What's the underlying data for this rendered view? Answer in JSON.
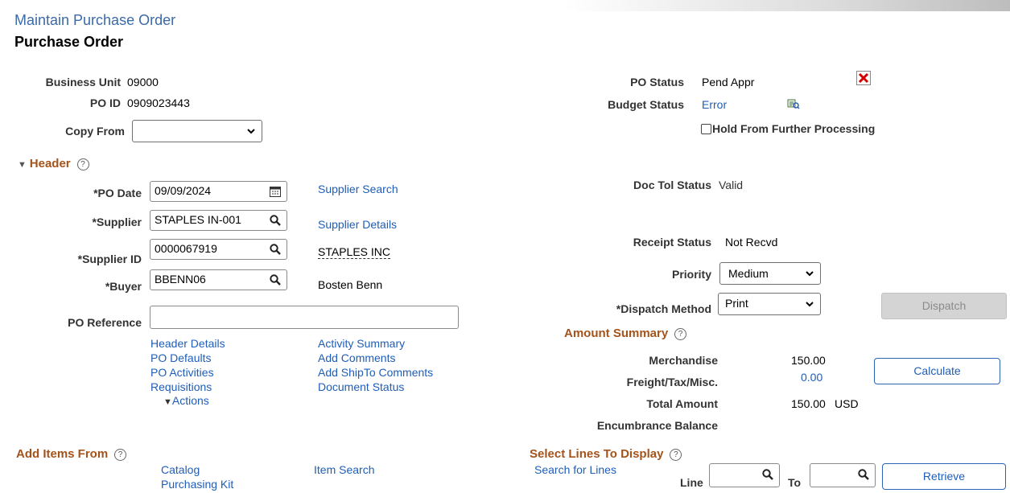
{
  "page": {
    "title": "Maintain Purchase Order",
    "subtitle": "Purchase Order"
  },
  "top": {
    "business_unit_label": "Business Unit",
    "business_unit": "09000",
    "po_id_label": "PO ID",
    "po_id": "0909023443",
    "copy_from_label": "Copy From",
    "copy_from_value": "",
    "po_status_label": "PO Status",
    "po_status": "Pend Appr",
    "budget_status_label": "Budget Status",
    "budget_status": "Error",
    "hold_label": "Hold From Further Processing"
  },
  "header": {
    "title": "Header",
    "po_date_label": "*PO Date",
    "po_date": "09/09/2024",
    "supplier_label": "*Supplier",
    "supplier": "STAPLES IN-001",
    "supplier_id_label": "*Supplier ID",
    "supplier_id": "0000067919",
    "supplier_name": "STAPLES INC",
    "buyer_label": "*Buyer",
    "buyer": "BBENN06",
    "buyer_name": "Bosten Benn",
    "po_reference_label": "PO Reference",
    "po_reference": "",
    "supplier_search": "Supplier Search",
    "supplier_details": "Supplier Details",
    "doc_tol_label": "Doc Tol Status",
    "doc_tol": "Valid",
    "receipt_label": "Receipt Status",
    "receipt": "Not Recvd",
    "priority_label": "Priority",
    "priority": "Medium",
    "dispatch_method_label": "*Dispatch Method",
    "dispatch_method": "Print",
    "dispatch_button": "Dispatch"
  },
  "links_left": [
    "Header Details",
    "PO Defaults",
    "PO Activities",
    "Requisitions"
  ],
  "links_right": [
    "Activity Summary",
    "Add Comments",
    "Add ShipTo Comments",
    "Document Status"
  ],
  "actions_label": "Actions",
  "amount": {
    "title": "Amount Summary",
    "merch_label": "Merchandise",
    "merch": "150.00",
    "freight_label": "Freight/Tax/Misc.",
    "freight": "0.00",
    "total_label": "Total Amount",
    "total": "150.00",
    "currency": "USD",
    "encumbrance_label": "Encumbrance Balance",
    "calculate": "Calculate"
  },
  "add_items": {
    "title": "Add Items From",
    "catalog": "Catalog",
    "purchasing_kit": "Purchasing Kit",
    "item_search": "Item Search"
  },
  "select_lines": {
    "title": "Select Lines To Display",
    "search": "Search for Lines",
    "line_label": "Line",
    "to_label": "To",
    "retrieve": "Retrieve"
  },
  "icons": {
    "lookup": "magnifier-icon",
    "calendar": "calendar-icon",
    "delete": "delete-x-icon",
    "budget": "budget-detail-icon"
  },
  "colors": {
    "link": "#1f5eb8",
    "section": "#a4531a",
    "title": "#3b6aa8",
    "error_x": "#d40000"
  }
}
